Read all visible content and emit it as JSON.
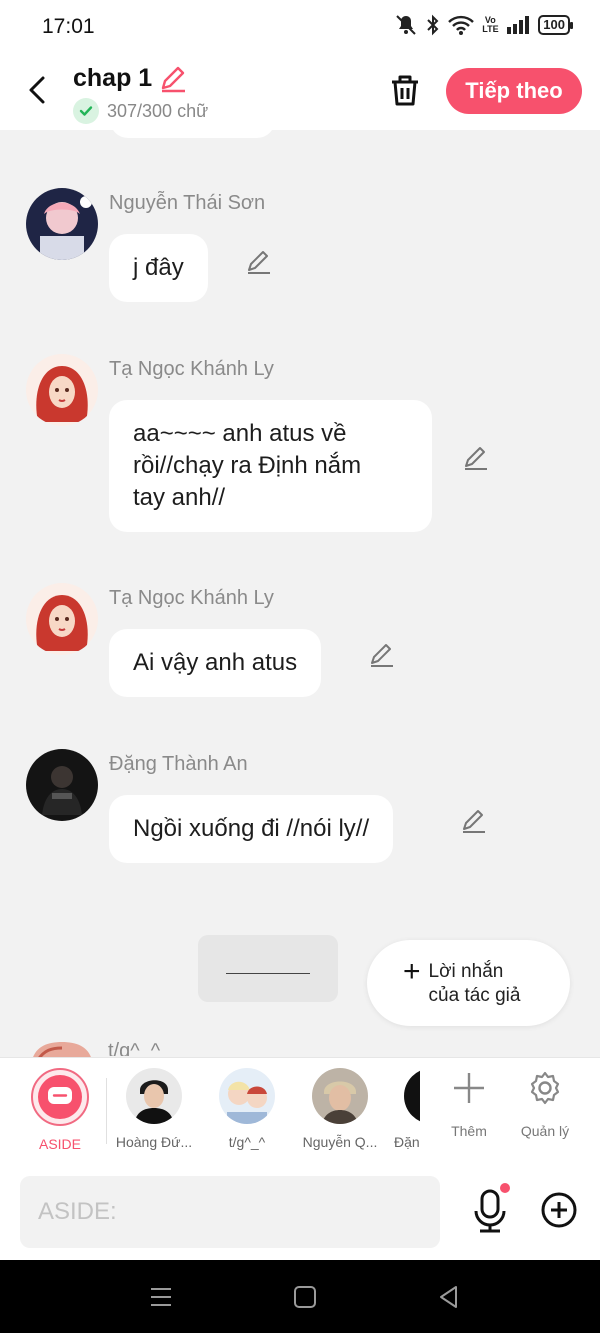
{
  "status_bar": {
    "time": "17:01",
    "battery": "100",
    "network": "Vo LTE"
  },
  "header": {
    "title": "chap 1",
    "word_count": "307/300 chữ",
    "next_label": "Tiếp theo",
    "accent_color": "#f7516d"
  },
  "messages": [
    {
      "sender": "Nguyễn Thái Sơn",
      "text": "j đây"
    },
    {
      "sender": "Tạ Ngọc Khánh Ly",
      "lines": [
        "aa~~~~ anh atus về",
        "rồi//chạy ra Định nắm",
        "tay anh//"
      ]
    },
    {
      "sender": "Tạ Ngọc Khánh Ly",
      "text": "Ai vậy anh atus"
    },
    {
      "sender": "Đặng Thành An",
      "text": "Ngồi xuống đi //nói ly//"
    }
  ],
  "author_note": {
    "plus": "+",
    "label": "Lời nhắn của tác giả"
  },
  "peek_sender": "t/g^_^",
  "characters": [
    {
      "name": "ASIDE"
    },
    {
      "name": "Hoàng Đứ..."
    },
    {
      "name": "t/g^_^"
    },
    {
      "name": "Nguyễn Q..."
    },
    {
      "name": "Đặn"
    }
  ],
  "tools": {
    "add": "Thêm",
    "manage": "Quản lý"
  },
  "input": {
    "placeholder": "ASIDE:"
  }
}
